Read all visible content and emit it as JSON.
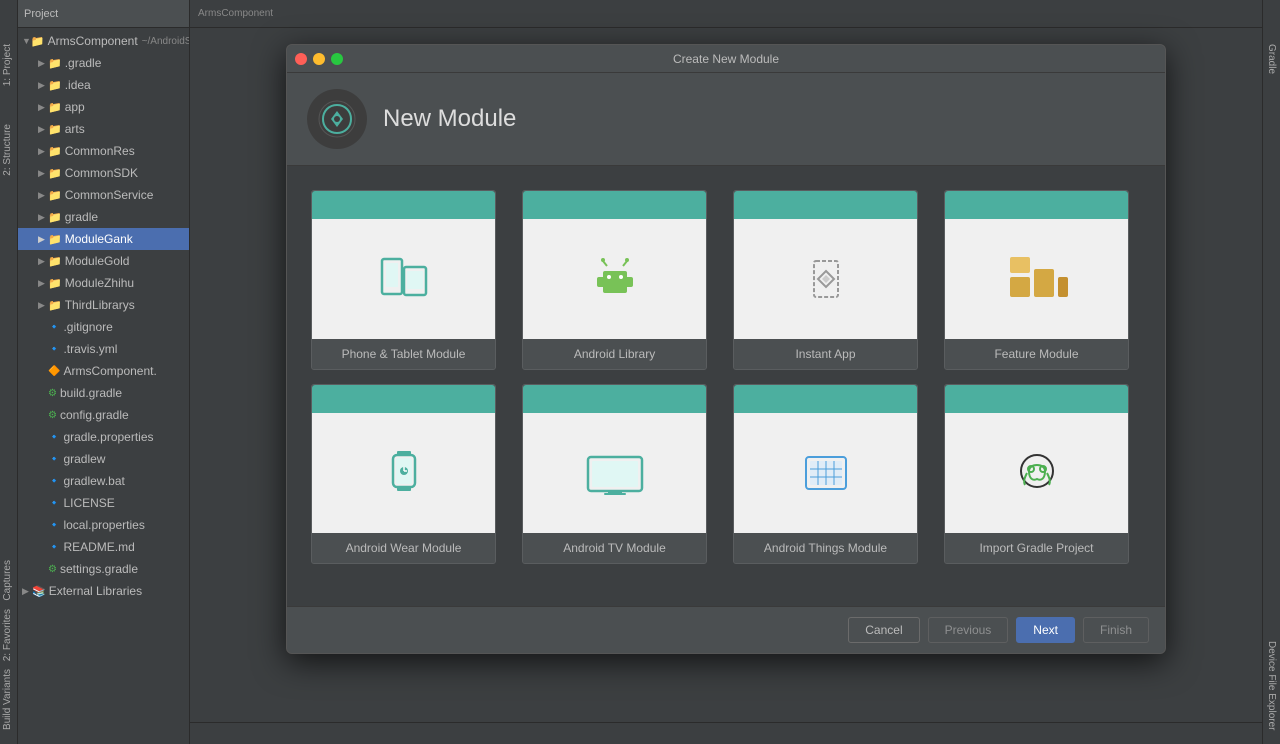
{
  "ide": {
    "title": "Project",
    "project_name": "ArmsComponent",
    "project_path": "~/AndroidStudio/"
  },
  "dialog": {
    "title": "Create New Module",
    "header_title": "New Module",
    "close_btn": "●",
    "minimize_btn": "●",
    "maximize_btn": "●"
  },
  "sidebar": {
    "items": [
      {
        "label": "ArmsComponent",
        "indent": 0,
        "type": "project",
        "expanded": true
      },
      {
        "label": ".gradle",
        "indent": 1,
        "type": "folder",
        "expanded": false
      },
      {
        "label": ".idea",
        "indent": 1,
        "type": "folder",
        "expanded": false
      },
      {
        "label": "app",
        "indent": 1,
        "type": "folder",
        "expanded": false
      },
      {
        "label": "arts",
        "indent": 1,
        "type": "folder",
        "expanded": false
      },
      {
        "label": "CommonRes",
        "indent": 1,
        "type": "folder",
        "expanded": false
      },
      {
        "label": "CommonSDK",
        "indent": 1,
        "type": "folder",
        "expanded": false
      },
      {
        "label": "CommonService",
        "indent": 1,
        "type": "folder",
        "expanded": false
      },
      {
        "label": "gradle",
        "indent": 1,
        "type": "folder",
        "expanded": false
      },
      {
        "label": "ModuleGank",
        "indent": 1,
        "type": "folder",
        "expanded": false,
        "selected": true
      },
      {
        "label": "ModuleGold",
        "indent": 1,
        "type": "folder",
        "expanded": false
      },
      {
        "label": "ModuleZhihu",
        "indent": 1,
        "type": "folder",
        "expanded": false
      },
      {
        "label": "ThirdLibrarys",
        "indent": 1,
        "type": "folder",
        "expanded": false
      },
      {
        "label": ".gitignore",
        "indent": 1,
        "type": "file"
      },
      {
        "label": ".travis.yml",
        "indent": 1,
        "type": "file"
      },
      {
        "label": "ArmsComponent.",
        "indent": 1,
        "type": "file"
      },
      {
        "label": "build.gradle",
        "indent": 1,
        "type": "gradle"
      },
      {
        "label": "config.gradle",
        "indent": 1,
        "type": "gradle"
      },
      {
        "label": "gradle.properties",
        "indent": 1,
        "type": "file"
      },
      {
        "label": "gradlew",
        "indent": 1,
        "type": "file"
      },
      {
        "label": "gradlew.bat",
        "indent": 1,
        "type": "file"
      },
      {
        "label": "LICENSE",
        "indent": 1,
        "type": "file"
      },
      {
        "label": "local.properties",
        "indent": 1,
        "type": "file"
      },
      {
        "label": "README.md",
        "indent": 1,
        "type": "file"
      },
      {
        "label": "settings.gradle",
        "indent": 1,
        "type": "gradle"
      },
      {
        "label": "External Libraries",
        "indent": 0,
        "type": "folder",
        "expanded": false
      }
    ],
    "panel_labels": [
      "1: Project",
      "2: Structure"
    ]
  },
  "modules": [
    {
      "id": "phone-tablet",
      "label": "Phone & Tablet Module",
      "icon_type": "phone-tablet"
    },
    {
      "id": "android-library",
      "label": "Android Library",
      "icon_type": "android-library"
    },
    {
      "id": "instant-app",
      "label": "Instant App",
      "icon_type": "instant-app"
    },
    {
      "id": "feature-module",
      "label": "Feature Module",
      "icon_type": "feature"
    },
    {
      "id": "android-wear",
      "label": "Android Wear Module",
      "icon_type": "wear"
    },
    {
      "id": "android-tv",
      "label": "Android TV Module",
      "icon_type": "tv"
    },
    {
      "id": "android-things",
      "label": "Android Things Module",
      "icon_type": "things"
    },
    {
      "id": "import-gradle",
      "label": "Import Gradle Project",
      "icon_type": "gradle"
    }
  ],
  "buttons": {
    "cancel": "Cancel",
    "previous": "Previous",
    "next": "Next",
    "finish": "Finish"
  },
  "right_panel": {
    "labels": [
      "Gradle",
      "Device File Explorer"
    ]
  }
}
